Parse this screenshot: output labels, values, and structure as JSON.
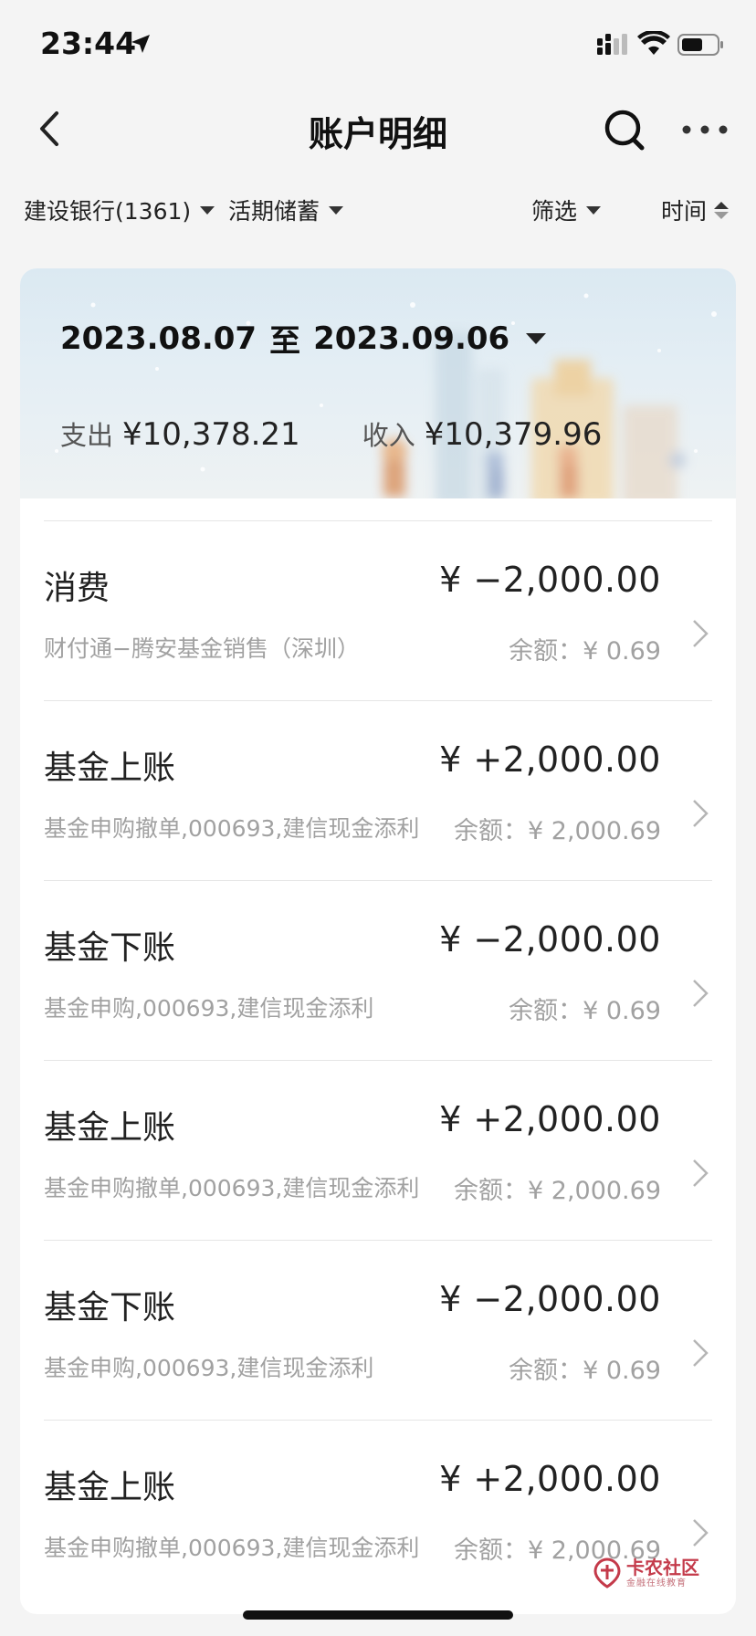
{
  "status_bar": {
    "time": "23:44"
  },
  "nav": {
    "title": "账户明细"
  },
  "filters": {
    "account": "建设银行(1361)",
    "account_type": "活期储蓄",
    "filter": "筛选",
    "sort": "时间"
  },
  "summary": {
    "date_from": "2023.08.07",
    "date_sep": "至",
    "date_to": "2023.09.06",
    "expense_label": "支出",
    "expense_value": "¥10,378.21",
    "income_label": "收入",
    "income_value": "¥10,379.96"
  },
  "transactions": [
    {
      "type": "消费",
      "amount": "¥ −2,000.00",
      "desc": "财付通−腾安基金销售（深圳）",
      "balance": "余额：¥ 0.69"
    },
    {
      "type": "基金上账",
      "amount": "¥ +2,000.00",
      "desc": "基金申购撤单,000693,建信现金添利",
      "balance": "余额：¥ 2,000.69"
    },
    {
      "type": "基金下账",
      "amount": "¥ −2,000.00",
      "desc": "基金申购,000693,建信现金添利",
      "balance": "余额：¥ 0.69"
    },
    {
      "type": "基金上账",
      "amount": "¥ +2,000.00",
      "desc": "基金申购撤单,000693,建信现金添利",
      "balance": "余额：¥ 2,000.69"
    },
    {
      "type": "基金下账",
      "amount": "¥ −2,000.00",
      "desc": "基金申购,000693,建信现金添利",
      "balance": "余额：¥ 0.69"
    },
    {
      "type": "基金上账",
      "amount": "¥ +2,000.00",
      "desc": "基金申购撤单,000693,建信现金添利",
      "balance": "余额：¥ 2,000.69"
    }
  ],
  "watermark": {
    "main": "卡农社区",
    "sub": "金融在线教育"
  },
  "icons": {
    "back": "chevron-left-icon",
    "search": "search-icon",
    "more": "more-dots-icon",
    "row_arrow": "chevron-right-icon"
  }
}
